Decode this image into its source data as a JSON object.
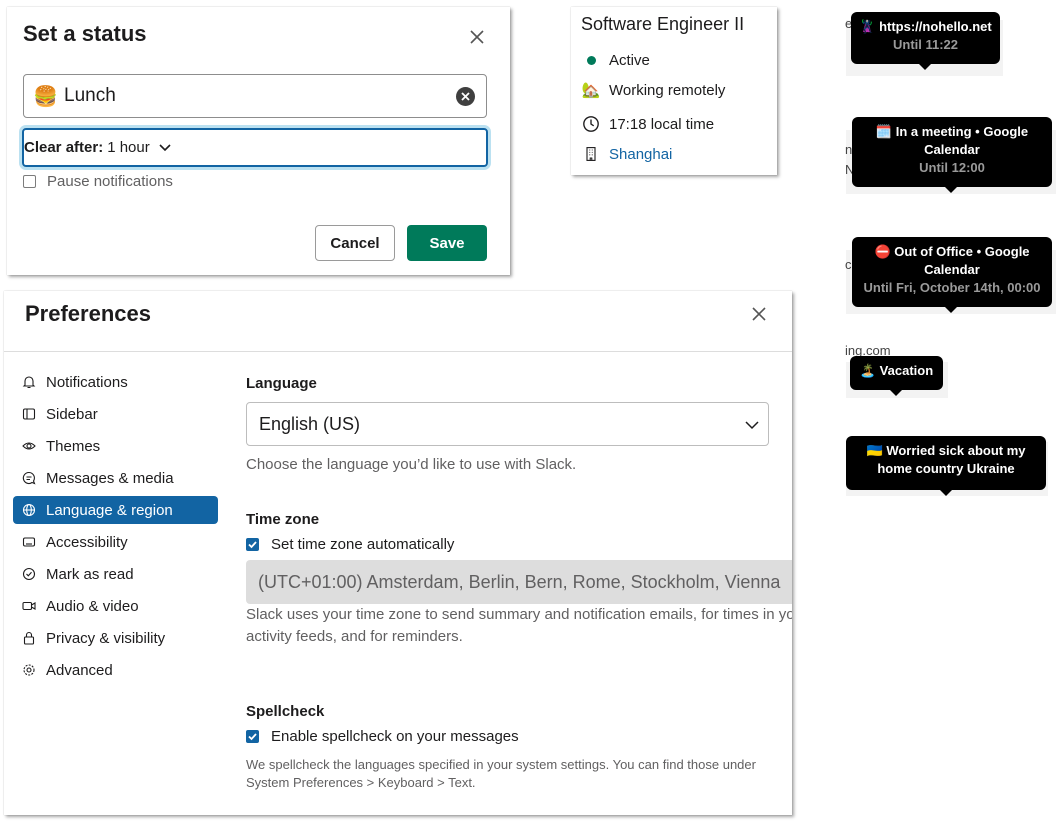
{
  "status_modal": {
    "title": "Set a status",
    "status_emoji": "🍔",
    "status_text": "Lunch",
    "clear_after_label": "Clear after:",
    "clear_after_value": "1 hour",
    "pause_label": "Pause notifications",
    "cancel_label": "Cancel",
    "save_label": "Save"
  },
  "profile": {
    "title": "Software Engineer II",
    "presence": "Active",
    "status_emoji": "🏡",
    "status": "Working remotely",
    "local_time": "17:18 local time",
    "location": "Shanghai"
  },
  "preferences": {
    "title": "Preferences",
    "nav": [
      {
        "label": "Notifications",
        "icon": "bell-icon"
      },
      {
        "label": "Sidebar",
        "icon": "sidebar-icon"
      },
      {
        "label": "Themes",
        "icon": "eye-icon"
      },
      {
        "label": "Messages & media",
        "icon": "message-icon"
      },
      {
        "label": "Language & region",
        "icon": "globe-icon",
        "active": true
      },
      {
        "label": "Accessibility",
        "icon": "keyboard-icon"
      },
      {
        "label": "Mark as read",
        "icon": "check-circle-icon"
      },
      {
        "label": "Audio & video",
        "icon": "video-icon"
      },
      {
        "label": "Privacy & visibility",
        "icon": "lock-icon"
      },
      {
        "label": "Advanced",
        "icon": "gear-icon"
      }
    ],
    "language": {
      "heading": "Language",
      "value": "English (US)",
      "help": "Choose the language you’d like to use with Slack."
    },
    "timezone": {
      "heading": "Time zone",
      "auto_label": "Set time zone automatically",
      "value": "(UTC+01:00) Amsterdam, Berlin, Bern, Rome, Stockholm, Vienna",
      "help_line1": "Slack uses your time zone to send summary and notification emails, for times in you",
      "help_line2": "activity feeds, and for reminders."
    },
    "spellcheck": {
      "heading": "Spellcheck",
      "enable_label": "Enable spellcheck on your messages",
      "help_line1": "We spellcheck the languages specified in your system settings. You can find those under",
      "help_line2": "System Preferences > Keyboard > Text."
    }
  },
  "tooltips": [
    {
      "emoji": "🦹",
      "line1": "https://nohello.net",
      "sub": "Until 11:22"
    },
    {
      "emoji": "🗓️",
      "line1": "In a meeting • Google",
      "line2": "Calendar",
      "sub": "Until 12:00"
    },
    {
      "emoji": "⛔",
      "line1": "Out of Office • Google",
      "line2": "Calendar",
      "sub": "Until Fri, October 14th, 00:00"
    },
    {
      "emoji": "🏝️",
      "line1": "Vacation"
    },
    {
      "emoji": "🇺🇦",
      "line1": "Worried sick about my",
      "line2": "home country Ukraine"
    }
  ],
  "ghost_fragments": [
    "e",
    "n",
    "N",
    "c",
    "ing.com"
  ],
  "colors": {
    "accent": "#1264a3",
    "save": "#007a5a",
    "presence": "#007a5a"
  }
}
